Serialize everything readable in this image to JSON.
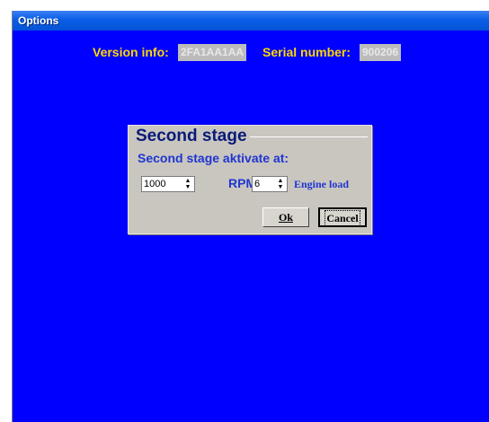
{
  "window": {
    "title": "Options"
  },
  "info": {
    "version_label": "Version info:",
    "version_value": "2FA1AA1AA",
    "serial_label": "Serial number:",
    "serial_value": "900206"
  },
  "panel": {
    "title": "Second stage",
    "subtitle": "Second stage aktivate at:",
    "rpm_value": "1000",
    "rpm_label": "RPM",
    "plus_symbol": "+",
    "load_value": "6",
    "load_label": "Engine load",
    "ok_label": "Ok",
    "cancel_label": "Cancel"
  },
  "colors": {
    "background": "#0000ff",
    "label_yellow": "#ffd700",
    "label_blue": "#1f35d0",
    "plus_red": "#e01010"
  }
}
